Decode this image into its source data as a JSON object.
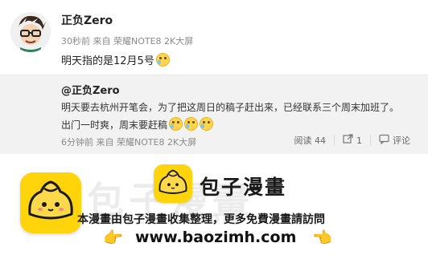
{
  "post": {
    "username": "正负Zero",
    "meta": "30秒前 来自 荣耀NOTE8 2K大屏",
    "text": "明天指的是12月5号"
  },
  "repost": {
    "author": "@正负Zero",
    "line1": "明天要去杭州开笔会，为了把这周日的稿子赶出来，已经联系三个周末加班了。",
    "line2": "出门一时爽，周末要赶稿",
    "meta": "6分钟前 来自 荣耀NOTE8 2K大屏",
    "stats": {
      "reads_label": "阅读 44",
      "repost_count": "1",
      "comment_label": "评论"
    }
  },
  "footer": {
    "brand": "包子漫畫",
    "watermark": "包子漫畫",
    "watermark_url": "baozimh.com",
    "notice": "本漫畫由包子漫畫收集整理，更多免費漫畫請訪問",
    "url": "www.baozimh.com",
    "hand_glyph": "👉",
    "hand_glyph_right": "👈"
  },
  "colors": {
    "bun_yellow": "#ffd40a",
    "repost_bg": "#f2f2f2",
    "meta_text": "#8a8a8a"
  },
  "icons": [
    "avatar",
    "cry-emoji",
    "repost-icon",
    "comment-icon",
    "bun-logo-icon",
    "hand-pointer-icon"
  ]
}
